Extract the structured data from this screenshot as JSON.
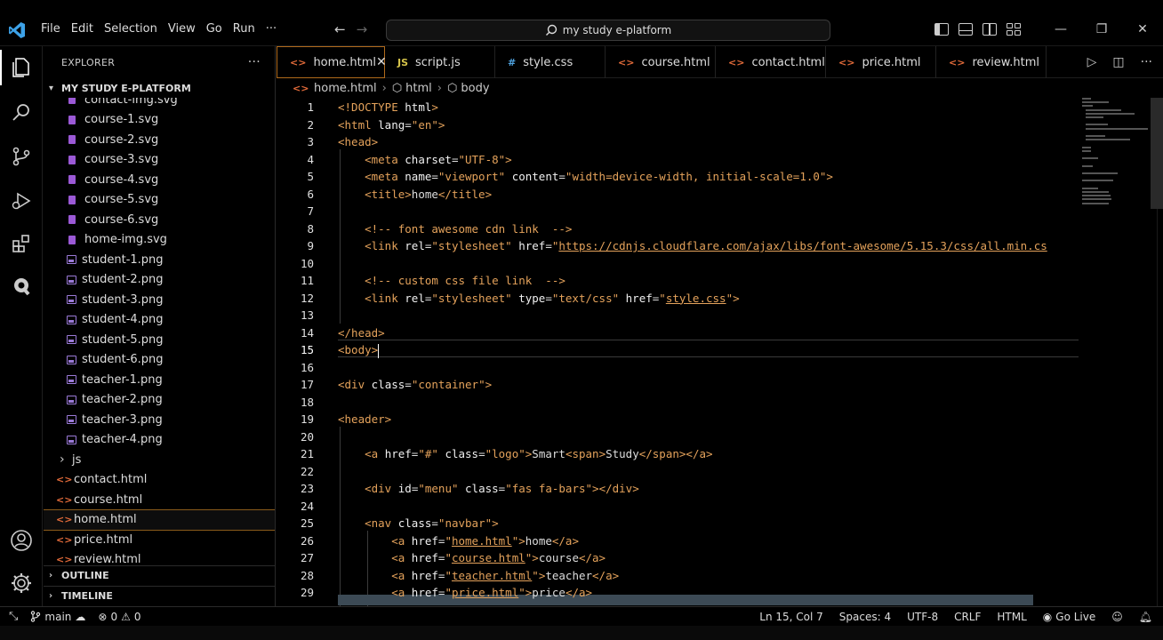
{
  "menu": [
    "File",
    "Edit",
    "Selection",
    "View",
    "Go",
    "Run",
    "···"
  ],
  "search": {
    "text": "my study e-platform"
  },
  "explorer": {
    "title": "EXPLORER",
    "more": "···",
    "project": "MY STUDY E-PLATFORM",
    "files": [
      {
        "name": "contact-img.svg",
        "type": "svg"
      },
      {
        "name": "course-1.svg",
        "type": "svg"
      },
      {
        "name": "course-2.svg",
        "type": "svg"
      },
      {
        "name": "course-3.svg",
        "type": "svg"
      },
      {
        "name": "course-4.svg",
        "type": "svg"
      },
      {
        "name": "course-5.svg",
        "type": "svg"
      },
      {
        "name": "course-6.svg",
        "type": "svg"
      },
      {
        "name": "home-img.svg",
        "type": "svg"
      },
      {
        "name": "student-1.png",
        "type": "png"
      },
      {
        "name": "student-2.png",
        "type": "png"
      },
      {
        "name": "student-3.png",
        "type": "png"
      },
      {
        "name": "student-4.png",
        "type": "png"
      },
      {
        "name": "student-5.png",
        "type": "png"
      },
      {
        "name": "student-6.png",
        "type": "png"
      },
      {
        "name": "teacher-1.png",
        "type": "png"
      },
      {
        "name": "teacher-2.png",
        "type": "png"
      },
      {
        "name": "teacher-3.png",
        "type": "png"
      },
      {
        "name": "teacher-4.png",
        "type": "png"
      },
      {
        "name": "js",
        "type": "folder"
      },
      {
        "name": "contact.html",
        "type": "html"
      },
      {
        "name": "course.html",
        "type": "html"
      },
      {
        "name": "home.html",
        "type": "html",
        "selected": true
      },
      {
        "name": "price.html",
        "type": "html"
      },
      {
        "name": "review.html",
        "type": "html"
      }
    ],
    "outline": "OUTLINE",
    "timeline": "TIMELINE"
  },
  "tabs": [
    {
      "label": "home.html",
      "icon": "<>",
      "iconColor": "#e36b3a",
      "active": true
    },
    {
      "label": "script.js",
      "icon": "JS",
      "iconColor": "#d6c44a"
    },
    {
      "label": "style.css",
      "icon": "#",
      "iconColor": "#4fa3e0"
    },
    {
      "label": "course.html",
      "icon": "<>",
      "iconColor": "#e36b3a"
    },
    {
      "label": "contact.html",
      "icon": "<>",
      "iconColor": "#e36b3a"
    },
    {
      "label": "price.html",
      "icon": "<>",
      "iconColor": "#e36b3a"
    },
    {
      "label": "review.html",
      "icon": "<>",
      "iconColor": "#e36b3a"
    }
  ],
  "breadcrumb": [
    "home.html",
    "html",
    "body"
  ],
  "code_lines": [
    {
      "n": "1",
      "indent": 0,
      "parts": [
        [
          "tg",
          "<!DOCTYPE "
        ],
        [
          "at",
          "html"
        ],
        [
          "tg",
          ">"
        ]
      ]
    },
    {
      "n": "2",
      "indent": 0,
      "parts": [
        [
          "tg",
          "<html "
        ],
        [
          "at",
          "lang"
        ],
        [
          "code",
          "="
        ],
        [
          "st",
          "\"en\""
        ],
        [
          "tg",
          ">"
        ]
      ]
    },
    {
      "n": "3",
      "indent": 0,
      "parts": [
        [
          "tg",
          "<head>"
        ]
      ]
    },
    {
      "n": "4",
      "indent": 1,
      "parts": [
        [
          "tg",
          "<meta "
        ],
        [
          "at",
          "charset"
        ],
        [
          "code",
          "="
        ],
        [
          "st",
          "\"UTF-8\""
        ],
        [
          "tg",
          ">"
        ]
      ]
    },
    {
      "n": "5",
      "indent": 1,
      "parts": [
        [
          "tg",
          "<meta "
        ],
        [
          "at",
          "name"
        ],
        [
          "code",
          "="
        ],
        [
          "st",
          "\"viewport\""
        ],
        [
          "code",
          " "
        ],
        [
          "at",
          "content"
        ],
        [
          "code",
          "="
        ],
        [
          "st",
          "\"width=device-width, initial-scale=1.0\""
        ],
        [
          "tg",
          ">"
        ]
      ]
    },
    {
      "n": "6",
      "indent": 1,
      "parts": [
        [
          "tg",
          "<title>"
        ],
        [
          "code",
          "home"
        ],
        [
          "tg",
          "</title>"
        ]
      ]
    },
    {
      "n": "7",
      "indent": 1,
      "parts": []
    },
    {
      "n": "8",
      "indent": 1,
      "parts": [
        [
          "cm",
          "<!-- font awesome cdn link  -->"
        ]
      ]
    },
    {
      "n": "9",
      "indent": 1,
      "parts": [
        [
          "tg",
          "<link "
        ],
        [
          "at",
          "rel"
        ],
        [
          "code",
          "="
        ],
        [
          "st",
          "\"stylesheet\""
        ],
        [
          "code",
          " "
        ],
        [
          "at",
          "href"
        ],
        [
          "code",
          "="
        ],
        [
          "st",
          "\""
        ],
        [
          "st ul",
          "https://cdnjs.cloudflare.com/ajax/libs/font-awesome/5.15.3/css/all.min.cs"
        ]
      ]
    },
    {
      "n": "10",
      "indent": 1,
      "parts": []
    },
    {
      "n": "11",
      "indent": 1,
      "parts": [
        [
          "cm",
          "<!-- custom css file link  -->"
        ]
      ]
    },
    {
      "n": "12",
      "indent": 1,
      "parts": [
        [
          "tg",
          "<link "
        ],
        [
          "at",
          "rel"
        ],
        [
          "code",
          "="
        ],
        [
          "st",
          "\"stylesheet\""
        ],
        [
          "code",
          " "
        ],
        [
          "at",
          "type"
        ],
        [
          "code",
          "="
        ],
        [
          "st",
          "\"text/css\""
        ],
        [
          "code",
          " "
        ],
        [
          "at",
          "href"
        ],
        [
          "code",
          "="
        ],
        [
          "st",
          "\""
        ],
        [
          "st ul",
          "style.css"
        ],
        [
          "st",
          "\""
        ],
        [
          "tg",
          ">"
        ]
      ]
    },
    {
      "n": "13",
      "indent": 1,
      "parts": []
    },
    {
      "n": "14",
      "indent": 0,
      "parts": [
        [
          "tg",
          "</head>"
        ]
      ]
    },
    {
      "n": "15",
      "indent": 0,
      "parts": [
        [
          "tg",
          "<body>"
        ]
      ],
      "current": true
    },
    {
      "n": "16",
      "indent": 0,
      "parts": []
    },
    {
      "n": "17",
      "indent": 0,
      "parts": [
        [
          "tg",
          "<div "
        ],
        [
          "at",
          "class"
        ],
        [
          "code",
          "="
        ],
        [
          "st",
          "\"container\""
        ],
        [
          "tg",
          ">"
        ]
      ]
    },
    {
      "n": "18",
      "indent": 0,
      "parts": []
    },
    {
      "n": "19",
      "indent": 0,
      "parts": [
        [
          "tg",
          "<header>"
        ]
      ]
    },
    {
      "n": "20",
      "indent": 1,
      "parts": []
    },
    {
      "n": "21",
      "indent": 1,
      "parts": [
        [
          "tg",
          "<a "
        ],
        [
          "at",
          "href"
        ],
        [
          "code",
          "="
        ],
        [
          "st",
          "\"#\""
        ],
        [
          "code",
          " "
        ],
        [
          "at",
          "class"
        ],
        [
          "code",
          "="
        ],
        [
          "st",
          "\"logo\""
        ],
        [
          "tg",
          ">"
        ],
        [
          "code",
          "Smart"
        ],
        [
          "tg",
          "<span>"
        ],
        [
          "code",
          "Study"
        ],
        [
          "tg",
          "</span></a>"
        ]
      ]
    },
    {
      "n": "22",
      "indent": 1,
      "parts": []
    },
    {
      "n": "23",
      "indent": 1,
      "parts": [
        [
          "tg",
          "<div "
        ],
        [
          "at",
          "id"
        ],
        [
          "code",
          "="
        ],
        [
          "st",
          "\"menu\""
        ],
        [
          "code",
          " "
        ],
        [
          "at",
          "class"
        ],
        [
          "code",
          "="
        ],
        [
          "st",
          "\"fas fa-bars\""
        ],
        [
          "tg",
          "></div>"
        ]
      ]
    },
    {
      "n": "24",
      "indent": 1,
      "parts": []
    },
    {
      "n": "25",
      "indent": 1,
      "parts": [
        [
          "tg",
          "<nav "
        ],
        [
          "at",
          "class"
        ],
        [
          "code",
          "="
        ],
        [
          "st",
          "\"navbar\""
        ],
        [
          "tg",
          ">"
        ]
      ]
    },
    {
      "n": "26",
      "indent": 2,
      "parts": [
        [
          "tg",
          "<a "
        ],
        [
          "at",
          "href"
        ],
        [
          "code",
          "="
        ],
        [
          "st",
          "\""
        ],
        [
          "st ul",
          "home.html"
        ],
        [
          "st",
          "\""
        ],
        [
          "tg",
          ">"
        ],
        [
          "code",
          "home"
        ],
        [
          "tg",
          "</a>"
        ]
      ]
    },
    {
      "n": "27",
      "indent": 2,
      "parts": [
        [
          "tg",
          "<a "
        ],
        [
          "at",
          "href"
        ],
        [
          "code",
          "="
        ],
        [
          "st",
          "\""
        ],
        [
          "st ul",
          "course.html"
        ],
        [
          "st",
          "\""
        ],
        [
          "tg",
          ">"
        ],
        [
          "code",
          "course"
        ],
        [
          "tg",
          "</a>"
        ]
      ]
    },
    {
      "n": "28",
      "indent": 2,
      "parts": [
        [
          "tg",
          "<a "
        ],
        [
          "at",
          "href"
        ],
        [
          "code",
          "="
        ],
        [
          "st",
          "\""
        ],
        [
          "st ul",
          "teacher.html"
        ],
        [
          "st",
          "\""
        ],
        [
          "tg",
          ">"
        ],
        [
          "code",
          "teacher"
        ],
        [
          "tg",
          "</a>"
        ]
      ]
    },
    {
      "n": "29",
      "indent": 2,
      "parts": [
        [
          "tg",
          "<a "
        ],
        [
          "at",
          "href"
        ],
        [
          "code",
          "="
        ],
        [
          "st",
          "\""
        ],
        [
          "st ul",
          "price.html"
        ],
        [
          "st",
          "\""
        ],
        [
          "tg",
          ">"
        ],
        [
          "code",
          "price"
        ],
        [
          "tg",
          "</a>"
        ]
      ]
    }
  ],
  "status": {
    "branch": "main",
    "errors": "0",
    "warnings": "0",
    "position": "Ln 15, Col 7",
    "spaces": "Spaces: 4",
    "encoding": "UTF-8",
    "eol": "CRLF",
    "language": "HTML",
    "golive": "Go Live"
  }
}
